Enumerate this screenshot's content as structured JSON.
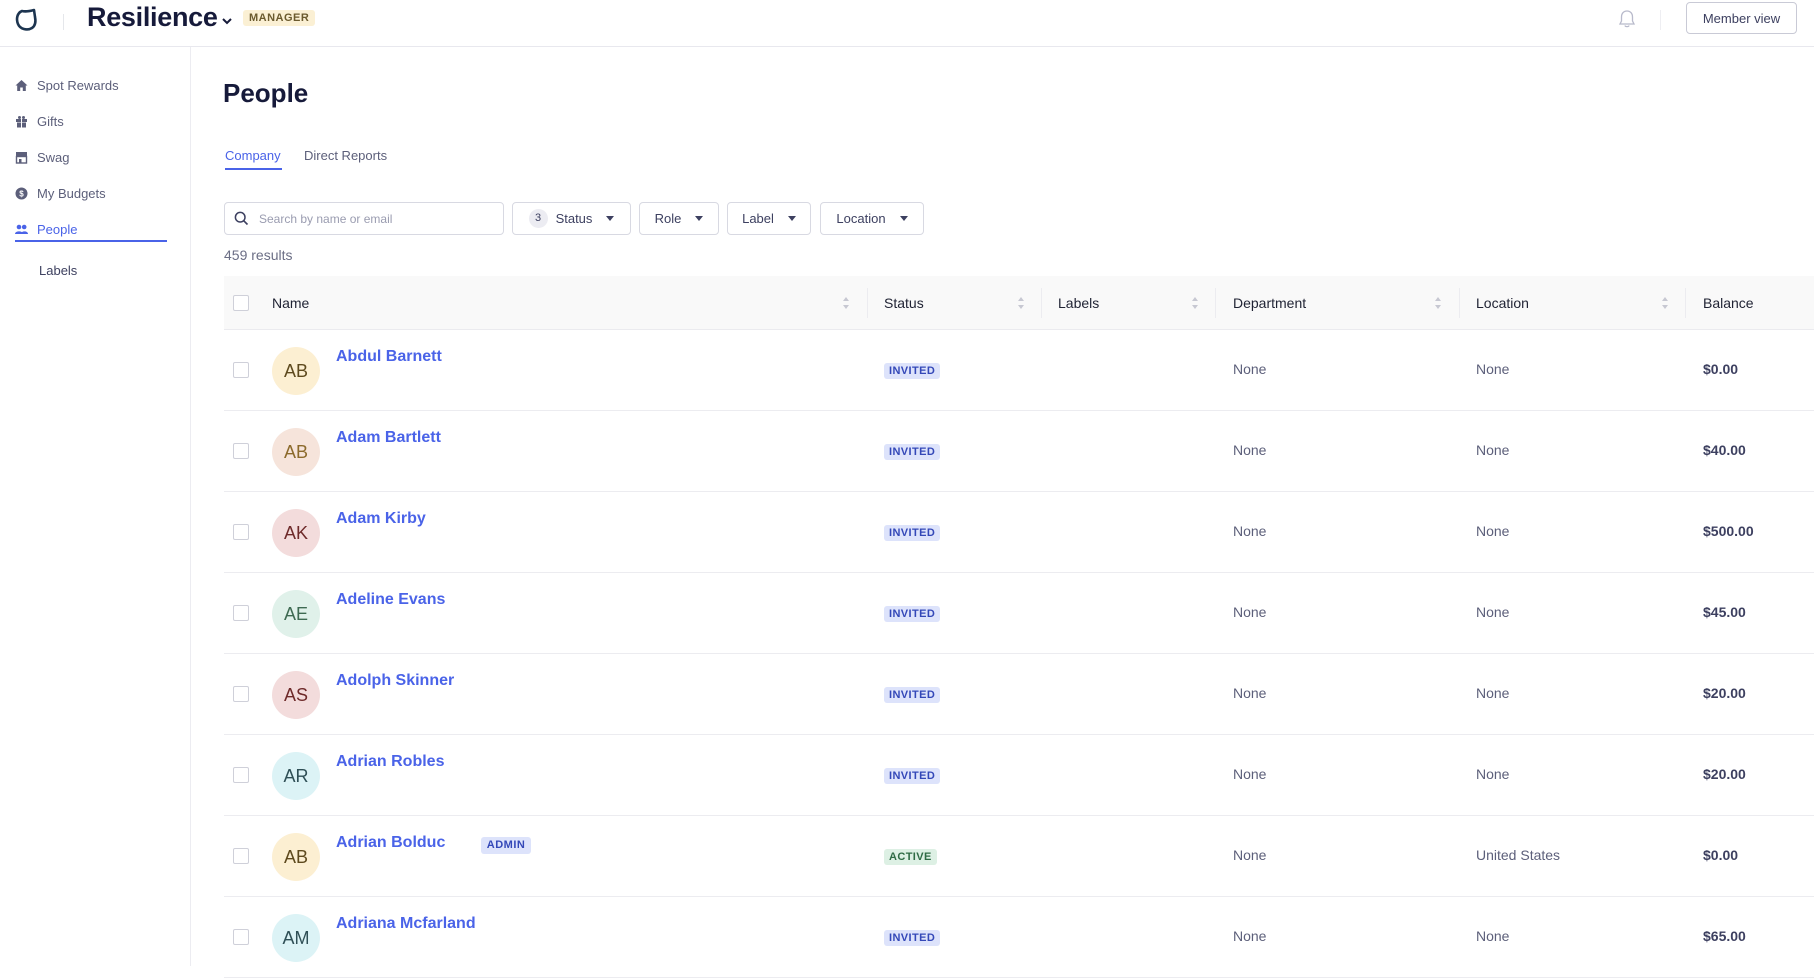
{
  "topbar": {
    "brand": "Resilience",
    "role_badge": "MANAGER",
    "member_view_label": "Member view",
    "icons": {
      "logo": "resilience-logo-icon",
      "brand_dropdown": "chevron-down-icon",
      "notifications": "bell-icon"
    }
  },
  "sidebar": {
    "items": [
      {
        "label": "Spot Rewards",
        "icon": "home-icon",
        "active": false
      },
      {
        "label": "Gifts",
        "icon": "gift-icon",
        "active": false
      },
      {
        "label": "Swag",
        "icon": "store-icon",
        "active": false
      },
      {
        "label": "My Budgets",
        "icon": "dollar-circle-icon",
        "active": false
      },
      {
        "label": "People",
        "icon": "people-icon",
        "active": true
      }
    ],
    "sub_items": [
      {
        "label": "Labels"
      }
    ]
  },
  "main": {
    "title": "People",
    "tabs": [
      {
        "label": "Company",
        "active": true
      },
      {
        "label": "Direct Reports",
        "active": false
      }
    ],
    "search": {
      "placeholder": "Search by name or email",
      "value": ""
    },
    "filters": [
      {
        "label": "Status",
        "count": "3"
      },
      {
        "label": "Role"
      },
      {
        "label": "Label"
      },
      {
        "label": "Location"
      }
    ],
    "results_text": "459 results",
    "table": {
      "columns": [
        "Name",
        "Status",
        "Labels",
        "Department",
        "Location",
        "Balance"
      ],
      "rows": [
        {
          "initials": "AB",
          "name": "Abdul Barnett",
          "badge": "",
          "status": "INVITED",
          "labels": "",
          "department": "None",
          "location": "None",
          "balance": "$0.00",
          "avatar_bg": "#fcefd2",
          "avatar_fg": "#5e4a1e"
        },
        {
          "initials": "AB",
          "name": "Adam Bartlett",
          "badge": "",
          "status": "INVITED",
          "labels": "",
          "department": "None",
          "location": "None",
          "balance": "$40.00",
          "avatar_bg": "#f6e4db",
          "avatar_fg": "#8c6a2c"
        },
        {
          "initials": "AK",
          "name": "Adam Kirby",
          "badge": "",
          "status": "INVITED",
          "labels": "",
          "department": "None",
          "location": "None",
          "balance": "$500.00",
          "avatar_bg": "#f3dcdc",
          "avatar_fg": "#6e2a2a"
        },
        {
          "initials": "AE",
          "name": "Adeline Evans",
          "badge": "",
          "status": "INVITED",
          "labels": "",
          "department": "None",
          "location": "None",
          "balance": "$45.00",
          "avatar_bg": "#e0f1ea",
          "avatar_fg": "#3e6a52"
        },
        {
          "initials": "AS",
          "name": "Adolph Skinner",
          "badge": "",
          "status": "INVITED",
          "labels": "",
          "department": "None",
          "location": "None",
          "balance": "$20.00",
          "avatar_bg": "#f3dcdc",
          "avatar_fg": "#6e2a2a"
        },
        {
          "initials": "AR",
          "name": "Adrian Robles",
          "badge": "",
          "status": "INVITED",
          "labels": "",
          "department": "None",
          "location": "None",
          "balance": "$20.00",
          "avatar_bg": "#dcf3f6",
          "avatar_fg": "#2f4f56"
        },
        {
          "initials": "AB",
          "name": "Adrian Bolduc",
          "badge": "ADMIN",
          "status": "ACTIVE",
          "labels": "",
          "department": "None",
          "location": "United States",
          "balance": "$0.00",
          "avatar_bg": "#fcefd2",
          "avatar_fg": "#5e4a1e"
        },
        {
          "initials": "AM",
          "name": "Adriana Mcfarland",
          "badge": "",
          "status": "INVITED",
          "labels": "",
          "department": "None",
          "location": "None",
          "balance": "$65.00",
          "avatar_bg": "#dcf3f6",
          "avatar_fg": "#2f4f56"
        }
      ]
    }
  },
  "colors": {
    "accent": "#4a63e8",
    "brand_text": "#161a3a",
    "invited_bg": "#dde3fb",
    "active_bg": "#ddf0e4"
  }
}
